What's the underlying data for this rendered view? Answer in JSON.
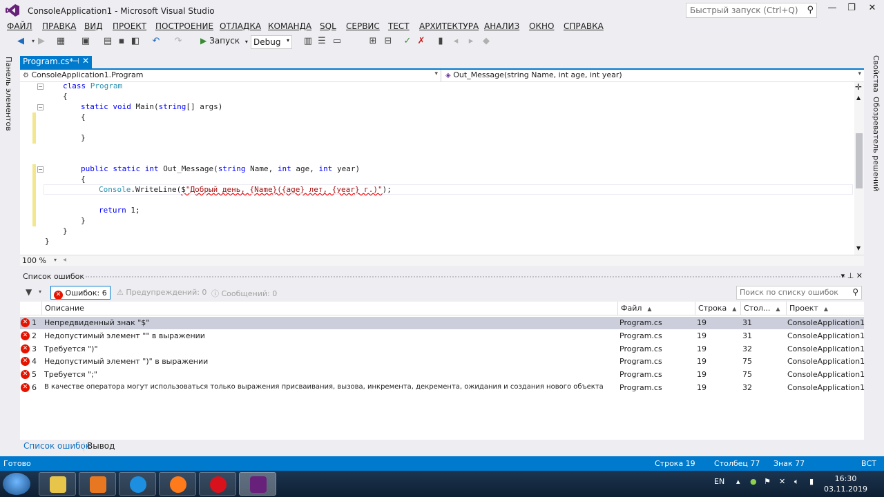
{
  "window": {
    "title": "ConsoleApplication1 - Microsoft Visual Studio",
    "quick_launch_placeholder": "Быстрый запуск (Ctrl+Q)"
  },
  "menu": [
    "ФАЙЛ",
    "ПРАВКА",
    "ВИД",
    "ПРОЕКТ",
    "ПОСТРОЕНИЕ",
    "ОТЛАДКА",
    "КОМАНДА",
    "SQL",
    "СЕРВИС",
    "ТЕСТ",
    "АРХИТЕКТУРА",
    "АНАЛИЗ",
    "ОКНО",
    "СПРАВКА"
  ],
  "toolbar": {
    "start_label": "Запуск",
    "config": "Debug"
  },
  "left_rail": {
    "toolbox_label": "Панель элементов"
  },
  "right_rail": {
    "properties_label": "Свойства",
    "solution_label": "Обозреватель решений"
  },
  "editor": {
    "tab_label": "Program.cs*",
    "nav_class": "ConsoleApplication1.Program",
    "nav_member": "Out_Message(string Name, int age, int year)",
    "zoom": "100 %"
  },
  "code": {
    "l1_kw": "class",
    "l1_name": "Program",
    "l2": "{",
    "l3_kw1": "static",
    "l3_kw2": "void",
    "l3_rest": "Main(",
    "l3_kw3": "string",
    "l3_tail": "[] args)",
    "l4": "{",
    "l6": "}",
    "l8_kw1": "public",
    "l8_kw2": "static",
    "l8_kw3": "int",
    "l8_name": "Out_Message(",
    "l8_kw4": "string",
    "l8_p1": "Name,",
    "l8_kw5": "int",
    "l8_p2": "age,",
    "l8_kw6": "int",
    "l8_p3": "year)",
    "l9": "{",
    "l10_type": "Console",
    "l10_call": ".WriteLine(",
    "l10_dollar": "$",
    "l10_str": "\"Добрый день, {Name}({age} лет, {year} г.)\"",
    "l10_end": ");",
    "l12_kw": "return",
    "l12_rest": "1;",
    "l13": "}",
    "l14": "}",
    "l15": "}"
  },
  "error_list": {
    "title": "Список ошибок",
    "errors_btn": "Ошибок: 6",
    "warnings_btn": "Предупреждений: 0",
    "messages_btn": "Сообщений: 0",
    "search_placeholder": "Поиск по списку ошибок",
    "columns": {
      "description": "Описание",
      "file": "Файл",
      "line": "Строка",
      "col": "Стол...",
      "project": "Проект"
    },
    "rows": [
      {
        "n": "1",
        "desc": "Непредвиденный знак \"$\"",
        "file": "Program.cs",
        "line": "19",
        "col": "31",
        "project": "ConsoleApplication1"
      },
      {
        "n": "2",
        "desc": "Недопустимый элемент \"\" в выражении",
        "file": "Program.cs",
        "line": "19",
        "col": "31",
        "project": "ConsoleApplication1"
      },
      {
        "n": "3",
        "desc": "Требуется \")\"",
        "file": "Program.cs",
        "line": "19",
        "col": "32",
        "project": "ConsoleApplication1"
      },
      {
        "n": "4",
        "desc": "Недопустимый элемент \")\" в выражении",
        "file": "Program.cs",
        "line": "19",
        "col": "75",
        "project": "ConsoleApplication1"
      },
      {
        "n": "5",
        "desc": "Требуется \";\"",
        "file": "Program.cs",
        "line": "19",
        "col": "75",
        "project": "ConsoleApplication1"
      },
      {
        "n": "6",
        "desc": "В качестве оператора могут использоваться только выражения присваивания, вызова, инкремента, декремента, ожидания и создания нового объекта",
        "file": "Program.cs",
        "line": "19",
        "col": "32",
        "project": "ConsoleApplication1"
      }
    ]
  },
  "bottom_tabs": {
    "errors": "Список ошибок",
    "output": "Вывод"
  },
  "status": {
    "ready": "Готово",
    "line": "Строка 19",
    "col": "Столбец 77",
    "char": "Знак 77",
    "mode": "ВСТ"
  },
  "taskbar": {
    "lang": "EN",
    "time": "16:30",
    "date": "03.11.2019"
  },
  "colors": {
    "accent": "#007acc",
    "error": "#e51400",
    "keyword": "#0000ff",
    "type": "#2b91af",
    "string": "#a31515"
  }
}
